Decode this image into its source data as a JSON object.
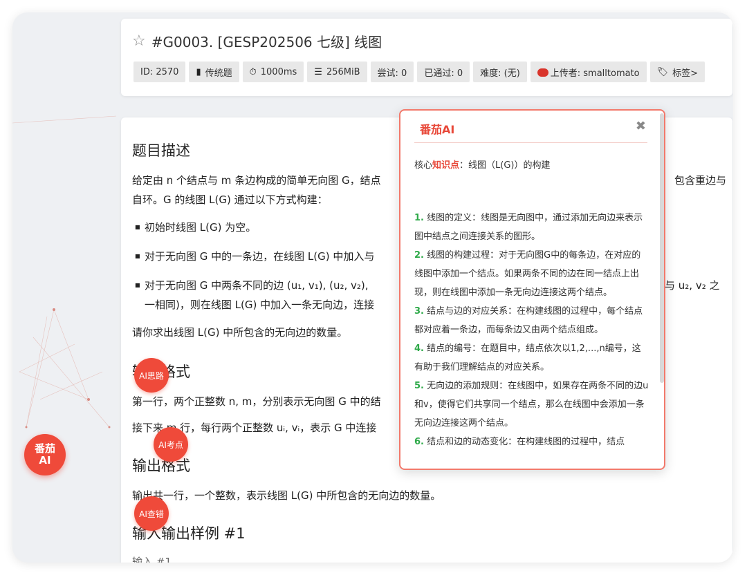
{
  "header": {
    "title": "#G0003. [GESP202506 七级] 线图",
    "tags": [
      {
        "label": "ID: 2570",
        "icon": ""
      },
      {
        "label": "传统题",
        "icon": "document-icon"
      },
      {
        "label": "1000ms",
        "icon": "timer-icon"
      },
      {
        "label": "256MiB",
        "icon": "memory-icon"
      },
      {
        "label": "尝试: 0",
        "icon": ""
      },
      {
        "label": "已通过: 0",
        "icon": ""
      },
      {
        "label": "难度: (无)",
        "icon": ""
      },
      {
        "label": "上传者: smalltomato",
        "icon": "avatar"
      },
      {
        "label": "标签>",
        "icon": "tag-icon"
      }
    ]
  },
  "problem": {
    "desc_title": "题目描述",
    "desc_line1": "给定由 n 个结点与 m 条边构成的简单无向图 G，结点",
    "desc_line1_tail": "包含重边与",
    "desc_line2": "自环。G 的线图 L(G) 通过以下方式构建：",
    "bullet1": "初始时线图 L(G) 为空。",
    "bullet2": "对于无向图 G 中的一条边，在线图 L(G) 中加入与",
    "bullet3": "对于无向图 G 中两条不同的边 (u₁, v₁), (u₂, v₂),",
    "bullet3_tail": "与 u₂, v₂ 之",
    "bullet3_line2": "一相同)，则在线图 L(G) 中加入一条无向边，连接",
    "ask": "请你求出线图 L(G) 中所包含的无向边的数量。",
    "input_title": "输入格式",
    "input_line1": "第一行，两个正整数 n, m，分别表示无向图 G 中的结",
    "input_line2": "接下来 m 行，每行两个正整数 uᵢ, vᵢ，表示 G 中连接",
    "output_title": "输出格式",
    "output_line": "输出共一行，一个整数，表示线图 L(G) 中所包含的无向边的数量。",
    "sample_title": "输入输出样例 #1",
    "sample_input": "输入 #1"
  },
  "ai": {
    "main_line1": "番茄",
    "main_line2": "AI",
    "bubble_thinking": "AI思路",
    "bubble_points": "AI考点",
    "bubble_debug": "AI查错"
  },
  "panel": {
    "title": "番茄AI",
    "core_prefix": "核心",
    "core_kp": "知识点",
    "core_suffix": "：线图（L(G)）的构建",
    "points": [
      {
        "num": "1.",
        "text": "线图的定义：线图是无向图中，通过添加无向边来表示图中结点之间连接关系的图形。"
      },
      {
        "num": "2.",
        "text": "线图的构建过程：对于无向图G中的每条边，在对应的线图中添加一个结点。如果两条不同的边在同一结点上出现，则在线图中添加一条无向边连接这两个结点。"
      },
      {
        "num": "3.",
        "text": "结点与边的对应关系：在构建线图的过程中，每个结点都对应着一条边，而每条边又由两个结点组成。"
      },
      {
        "num": "4.",
        "text": "结点的编号：在题目中，结点依次以1,2,...,n编号，这有助于我们理解结点的对应关系。"
      },
      {
        "num": "5.",
        "text": "无向边的添加规则：在线图中，如果存在两条不同的边u和v，使得它们共享同一个结点，那么在线图中会添加一条无向边连接这两个结点。"
      },
      {
        "num": "6.",
        "text": "结点和边的动态变化：在构建线图的过程中，结点"
      }
    ]
  },
  "colors": {
    "accent": "#ef4a3a",
    "green": "#2faa4a"
  }
}
